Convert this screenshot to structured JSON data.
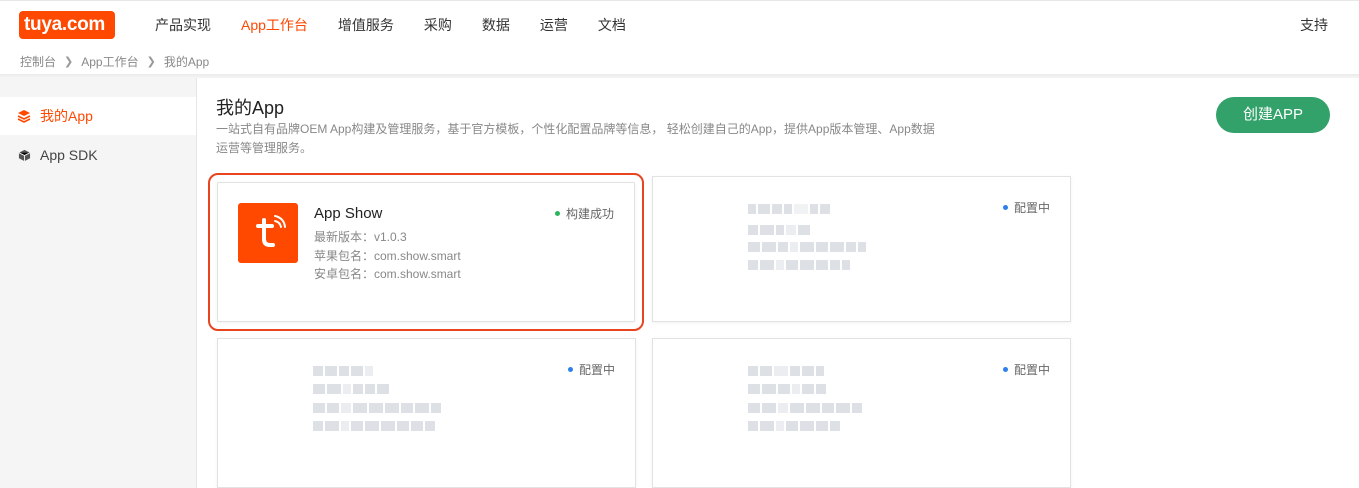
{
  "brand": {
    "logo_text": "tuya.com",
    "accent": "#ff4800",
    "green": "#32a16a"
  },
  "nav": {
    "items": [
      "产品实现",
      "App工作台",
      "增值服务",
      "采购",
      "数据",
      "运营",
      "文档"
    ],
    "active_index": 1,
    "support": "支持"
  },
  "breadcrumb": [
    "控制台",
    "App工作台",
    "我的App"
  ],
  "sidebar": {
    "items": [
      {
        "label": "我的App",
        "icon": "layers-icon",
        "active": true
      },
      {
        "label": "App SDK",
        "icon": "cube-icon",
        "active": false
      }
    ]
  },
  "main": {
    "title": "我的App",
    "description": "一站式自有品牌OEM App构建及管理服务，基于官方模板，个性化配置品牌等信息， 轻松创建自己的App，提供App版本管理、App数据运营等管理服务。",
    "create_button": "创建APP"
  },
  "cards": [
    {
      "name": "App Show",
      "version": "最新版本：v1.0.3",
      "ios_package": "苹果包名：com.show.smart",
      "android_package": "安卓包名：com.show.smart",
      "status": "构建成功",
      "status_color": "#2db55d",
      "selected": true
    },
    {
      "status": "配置中",
      "status_color": "#2f80ed",
      "redacted": true
    },
    {
      "status": "配置中",
      "status_color": "#2f80ed",
      "redacted": true
    },
    {
      "status": "配置中",
      "status_color": "#2f80ed",
      "redacted": true
    }
  ]
}
